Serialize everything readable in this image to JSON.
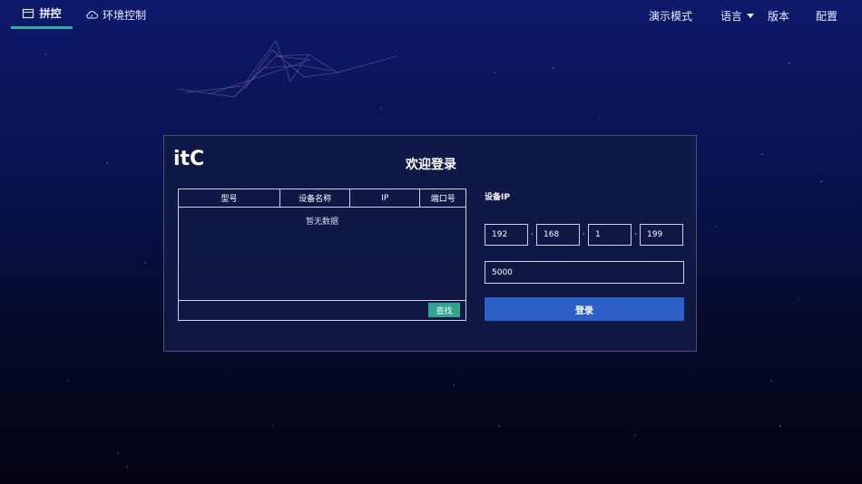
{
  "topbar": {
    "tabs": [
      {
        "label": "拼控",
        "icon": "monitor-icon",
        "active": true
      },
      {
        "label": "环境控制",
        "icon": "cloud-icon",
        "active": false
      }
    ],
    "menu": {
      "demo": "演示模式",
      "language": "语言",
      "version": "版本",
      "config": "配置"
    }
  },
  "login": {
    "logo_text": "itC",
    "title": "欢迎登录",
    "table": {
      "columns": [
        "型号",
        "设备名称",
        "IP",
        "端口号"
      ],
      "empty_text": "暂无数据",
      "find_label": "查找"
    },
    "device_ip_label": "设备IP",
    "ip": [
      "192",
      "168",
      "1",
      "199"
    ],
    "port": "5000",
    "login_label": "登录"
  },
  "colors": {
    "accent": "#27b3a0",
    "login_button": "#2c5fc7",
    "find_button": "#2fa58f"
  }
}
